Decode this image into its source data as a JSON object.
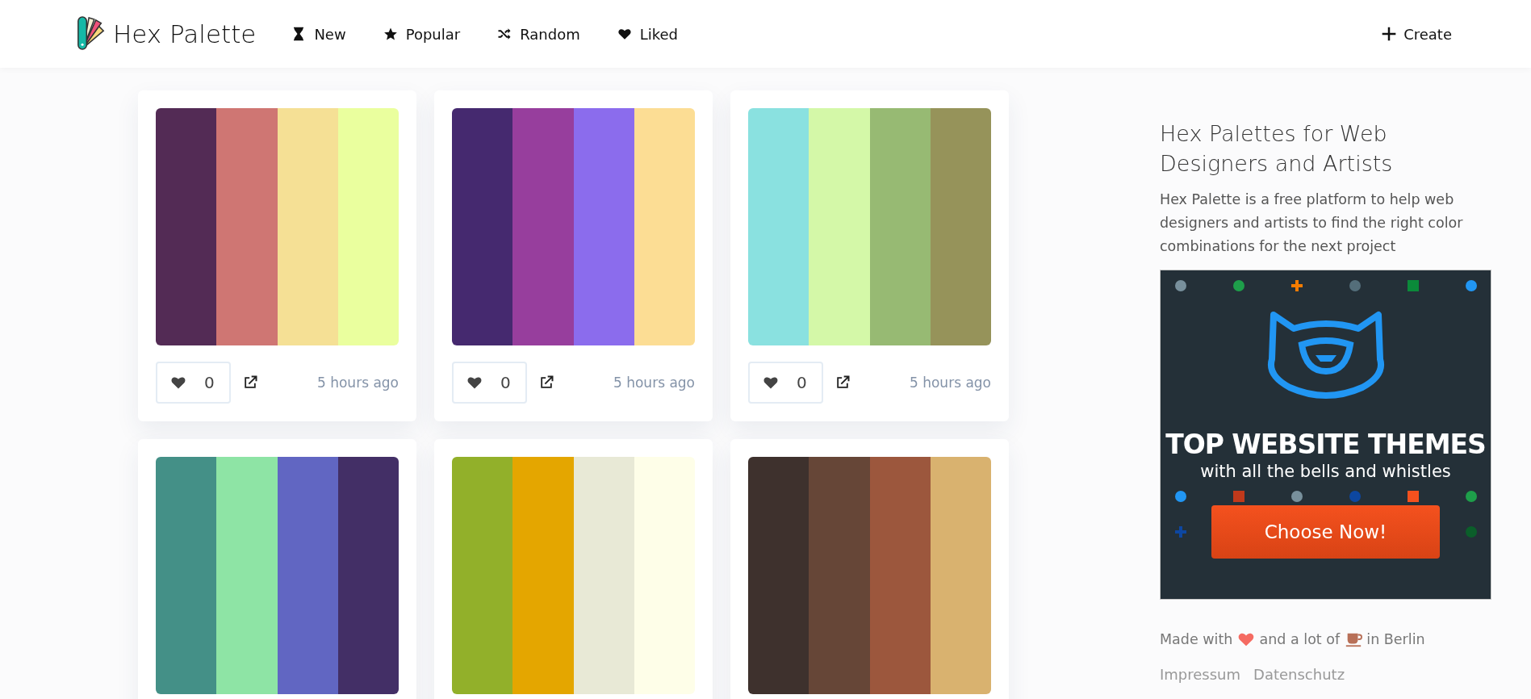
{
  "header": {
    "brand": "Hex Palette",
    "nav": [
      {
        "label": "New"
      },
      {
        "label": "Popular"
      },
      {
        "label": "Random"
      },
      {
        "label": "Liked"
      }
    ],
    "create": "Create"
  },
  "palettes": [
    {
      "swatches": [
        {
          "color": "#532b55"
        },
        {
          "color": "#cf7673"
        },
        {
          "color": "#f5e095"
        },
        {
          "color": "#eaff9e"
        }
      ],
      "likes": "0",
      "time": "5 hours ago"
    },
    {
      "swatches": [
        {
          "color": "#45296f"
        },
        {
          "color": "#973e9d"
        },
        {
          "color": "#8b6ced"
        },
        {
          "color": "#fcdd94"
        }
      ],
      "likes": "0",
      "time": "5 hours ago"
    },
    {
      "swatches": [
        {
          "color": "#8ae1e0"
        },
        {
          "color": "#d4f8a8"
        },
        {
          "color": "#97ba73"
        },
        {
          "color": "#96935a"
        }
      ],
      "likes": "0",
      "time": "5 hours ago"
    },
    {
      "swatches": [
        {
          "color": "#449087"
        },
        {
          "color": "#8ee4a5"
        },
        {
          "color": "#6166c2"
        },
        {
          "color": "#432f66"
        }
      ]
    },
    {
      "swatches": [
        {
          "color": "#92b02a"
        },
        {
          "color": "#e4a600"
        },
        {
          "color": "#e8e9d6"
        },
        {
          "color": "#fefee8"
        }
      ]
    },
    {
      "swatches": [
        {
          "color": "#3e312d"
        },
        {
          "color": "#664637"
        },
        {
          "color": "#9c573d"
        },
        {
          "color": "#d9b26f"
        }
      ]
    }
  ],
  "sidebar": {
    "title": "Hex Palettes for Web Designers and Artists",
    "text": "Hex Palette is a free platform to help web designers and artists to find the right color combinations for the next project",
    "ad": {
      "headline": "TOP WEBSITE THEMES",
      "tagline": "with all the bells and whistles",
      "button": "Choose Now!"
    },
    "footer": {
      "made_with": [
        "Made with",
        "and a lot of",
        "in Berlin"
      ],
      "links": [
        "Impressum",
        "Datenschutz"
      ]
    }
  }
}
